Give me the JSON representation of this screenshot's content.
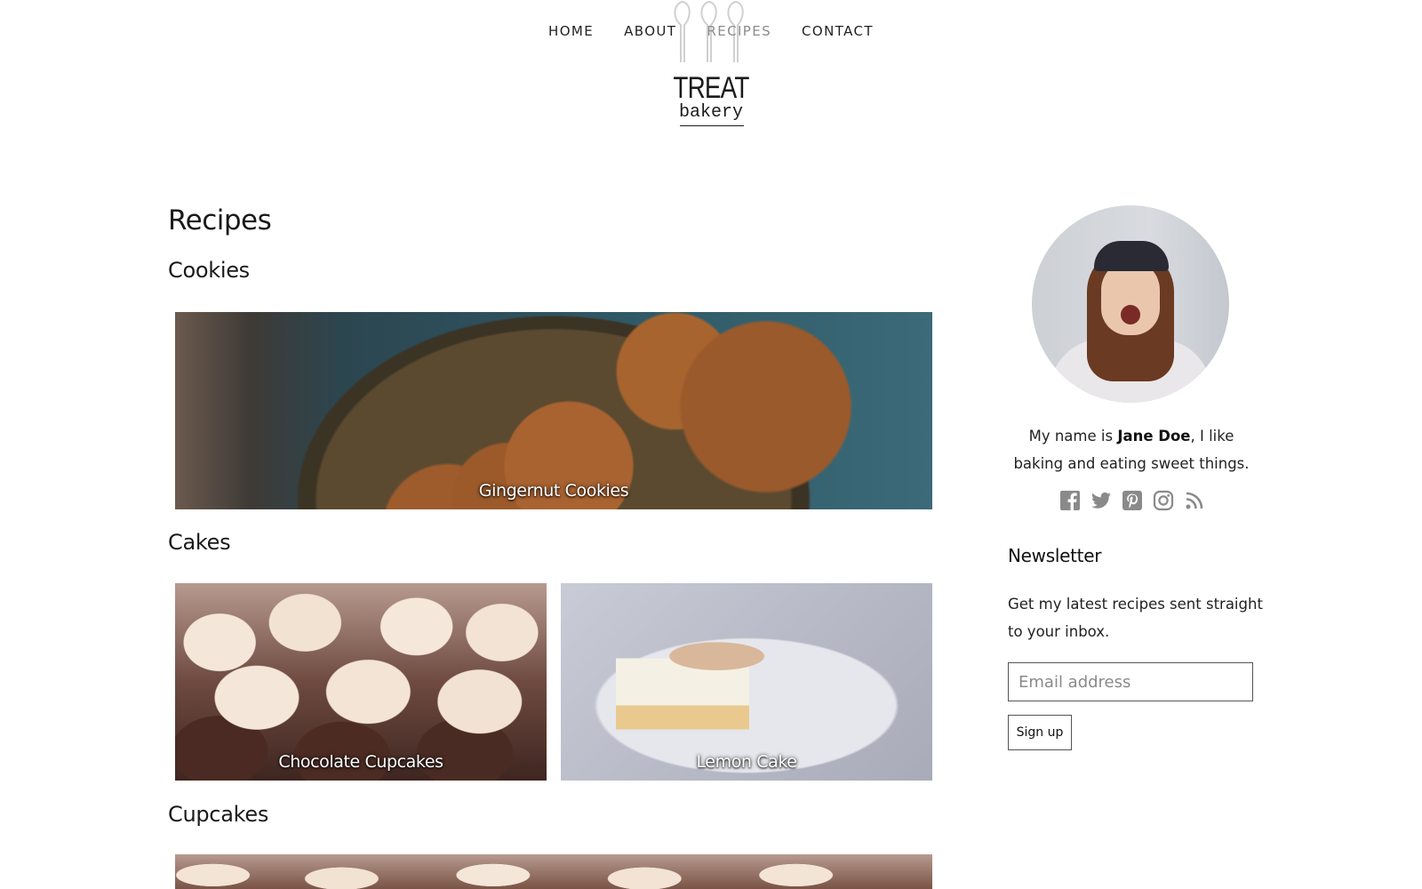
{
  "nav": {
    "items": [
      {
        "label": "HOME"
      },
      {
        "label": "ABOUT"
      },
      {
        "label": "RECIPES",
        "active": true
      },
      {
        "label": "CONTACT"
      }
    ]
  },
  "logo": {
    "title": "TREAT",
    "subtitle": "bakery"
  },
  "main": {
    "page_title": "Recipes",
    "sections": [
      {
        "title": "Cookies",
        "cards": [
          {
            "caption": "Gingernut Cookies"
          }
        ]
      },
      {
        "title": "Cakes",
        "cards": [
          {
            "caption": "Chocolate Cupcakes"
          },
          {
            "caption": "Lemon Cake"
          }
        ]
      },
      {
        "title": "Cupcakes",
        "cards": []
      }
    ]
  },
  "sidebar": {
    "bio": {
      "prefix": "My name is ",
      "name": "Jane Doe",
      "suffix": ", I like baking and eating sweet things."
    },
    "social_icons": [
      "facebook-icon",
      "twitter-icon",
      "pinterest-icon",
      "instagram-icon",
      "rss-icon"
    ],
    "newsletter": {
      "title": "Newsletter",
      "text": "Get my latest recipes sent straight to your inbox.",
      "email_placeholder": "Email address",
      "button_label": "Sign up"
    }
  },
  "colors": {
    "nav_active": "#8c8c8c",
    "text": "#1a1a1a",
    "icon": "#8a8a8a"
  }
}
